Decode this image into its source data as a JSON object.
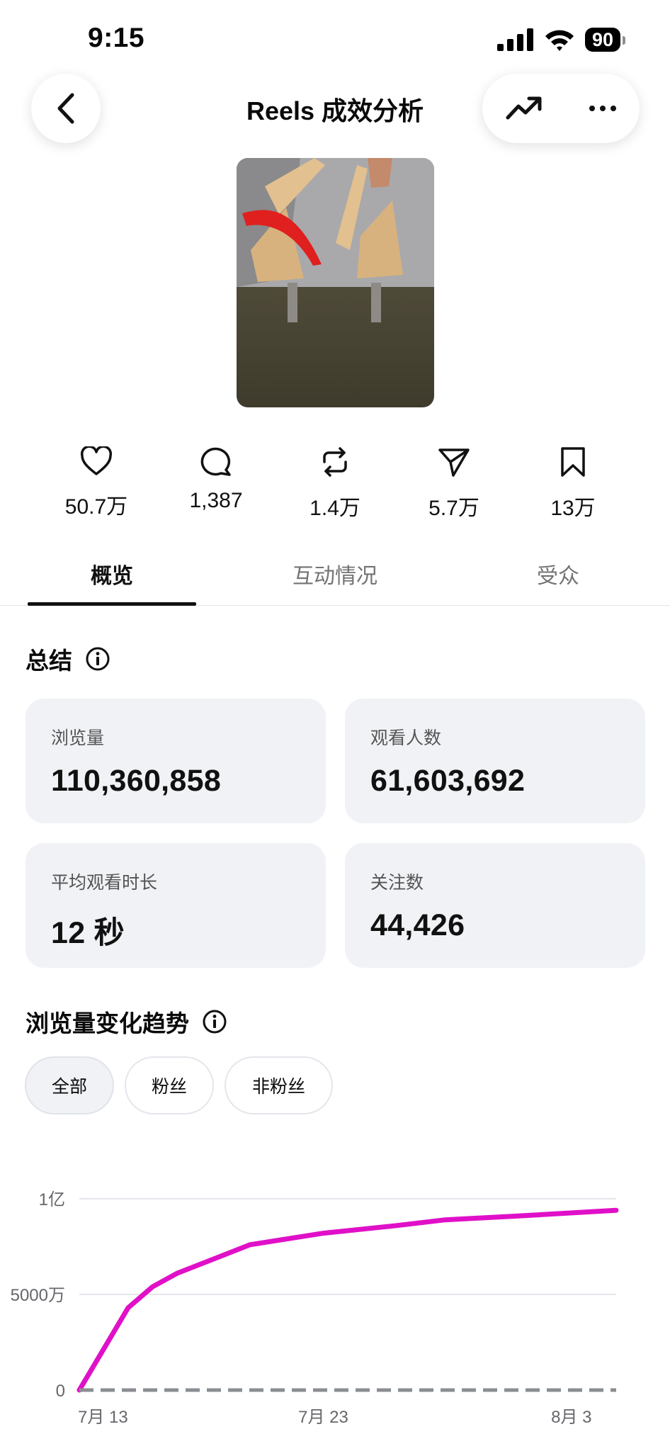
{
  "status_bar": {
    "time": "9:15",
    "battery": "90"
  },
  "header": {
    "title": "Reels 成效分析"
  },
  "metrics": [
    {
      "icon": "heart-icon",
      "value": "50.7万"
    },
    {
      "icon": "comment-icon",
      "value": "1,387"
    },
    {
      "icon": "repost-icon",
      "value": "1.4万"
    },
    {
      "icon": "send-icon",
      "value": "5.7万"
    },
    {
      "icon": "bookmark-icon",
      "value": "13万"
    }
  ],
  "tabs": [
    {
      "label": "概览",
      "active": true
    },
    {
      "label": "互动情况",
      "active": false
    },
    {
      "label": "受众",
      "active": false
    }
  ],
  "summary": {
    "title": "总结",
    "cards": [
      {
        "label": "浏览量",
        "value": "110,360,858"
      },
      {
        "label": "观看人数",
        "value": "61,603,692"
      },
      {
        "label": "平均观看时长",
        "value": "12 秒"
      },
      {
        "label": "关注数",
        "value": "44,426"
      }
    ]
  },
  "trend": {
    "title": "浏览量变化趋势",
    "filters": [
      {
        "label": "全部",
        "active": true
      },
      {
        "label": "粉丝",
        "active": false
      },
      {
        "label": "非粉丝",
        "active": false
      }
    ]
  },
  "colors": {
    "series_main": "#e010c8",
    "series_baseline": "#8a8d91",
    "card_bg": "#f0f2f5"
  },
  "chart_data": {
    "type": "line",
    "y_tick_labels": [
      "0",
      "5000万",
      "1亿"
    ],
    "y_ticks": [
      0,
      50000000,
      100000000
    ],
    "ylim": [
      0,
      100000000
    ],
    "x_tick_labels": [
      "7月 13",
      "7月 23",
      "8月 3"
    ],
    "x_ticks": [
      0,
      10,
      21
    ],
    "xlim": [
      0,
      22
    ],
    "series": [
      {
        "color": "#e010c8",
        "x": [
          0,
          2,
          3,
          4,
          5,
          7,
          10,
          13,
          15,
          18,
          22
        ],
        "values": [
          0,
          43000000,
          54000000,
          61000000,
          66000000,
          76000000,
          82000000,
          86000000,
          89000000,
          91000000,
          94000000
        ]
      },
      {
        "color": "#8a8d91",
        "dashed": true,
        "x": [
          0,
          22
        ],
        "values": [
          0,
          0
        ]
      }
    ]
  }
}
